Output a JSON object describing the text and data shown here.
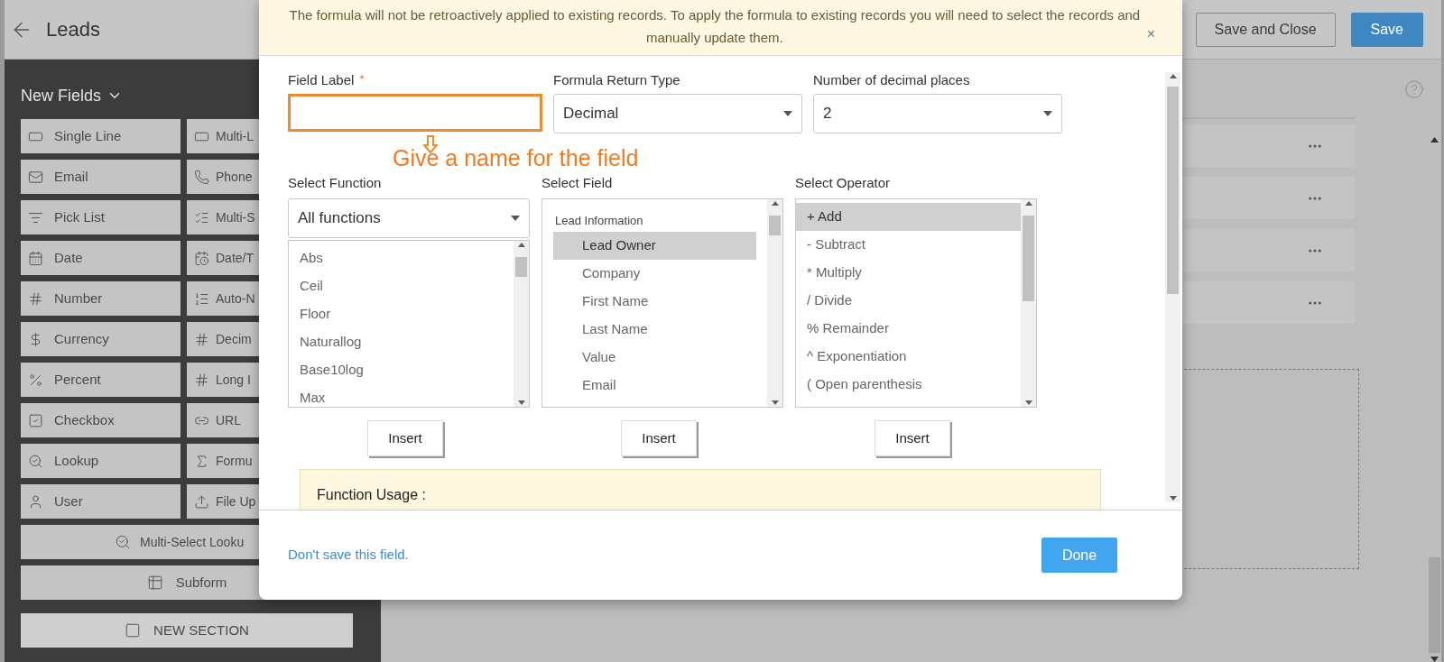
{
  "header": {
    "title": "Leads",
    "buttons": [
      {
        "label": "Save and Close",
        "kind": "secondary"
      },
      {
        "label": "Save",
        "kind": "primary"
      }
    ]
  },
  "sidebar": {
    "heading": "New Fields",
    "fields": [
      {
        "label": "Single Line"
      },
      {
        "label": "Multi-L"
      },
      {
        "label": "Email"
      },
      {
        "label": "Phone"
      },
      {
        "label": "Pick List"
      },
      {
        "label": "Multi-S"
      },
      {
        "label": "Date"
      },
      {
        "label": "Date/T"
      },
      {
        "label": "Number"
      },
      {
        "label": "Auto-N"
      },
      {
        "label": "Currency"
      },
      {
        "label": "Decim"
      },
      {
        "label": "Percent"
      },
      {
        "label": "Long I"
      },
      {
        "label": "Checkbox"
      },
      {
        "label": "URL"
      },
      {
        "label": "Lookup"
      },
      {
        "label": "Formu"
      },
      {
        "label": "User"
      },
      {
        "label": "File Up"
      }
    ],
    "wide_fields": [
      {
        "label": "Multi-Select Looku"
      },
      {
        "label": "Subform"
      },
      {
        "label": "NEW SECTION"
      }
    ]
  },
  "dialog": {
    "notice": "The formula will not be retroactively applied to existing records. To apply the formula to existing records you will need to select the records and manually update them.",
    "close": "×",
    "field_label": {
      "label": "Field Label",
      "required": "*"
    },
    "return_type": {
      "label": "Formula Return Type",
      "value": "Decimal"
    },
    "decimal_places": {
      "label": "Number of decimal places",
      "value": "2"
    },
    "annotation": "Give a name for the field",
    "lists": [
      {
        "label": "Select Function",
        "dropdown": "All functions",
        "items": [
          {
            "label": "Abs",
            "selected": false
          },
          {
            "label": "Ceil",
            "selected": false
          },
          {
            "label": "Floor",
            "selected": false
          },
          {
            "label": "Naturallog",
            "selected": false
          },
          {
            "label": "Base10log",
            "selected": false
          },
          {
            "label": "Max",
            "selected": false
          }
        ],
        "insert": "Insert"
      },
      {
        "label": "Select Field",
        "group": "Lead Information",
        "items": [
          {
            "label": "Lead Owner",
            "selected": true
          },
          {
            "label": "Company",
            "selected": false
          },
          {
            "label": "First Name",
            "selected": false
          },
          {
            "label": "Last Name",
            "selected": false
          },
          {
            "label": "Value",
            "selected": false
          },
          {
            "label": "Email",
            "selected": false
          }
        ],
        "insert": "Insert"
      },
      {
        "label": "Select Operator",
        "items": [
          {
            "label": "+ Add",
            "selected": true
          },
          {
            "label": "- Subtract",
            "selected": false
          },
          {
            "label": "* Multiply",
            "selected": false
          },
          {
            "label": "/ Divide",
            "selected": false
          },
          {
            "label": "% Remainder",
            "selected": false
          },
          {
            "label": "^ Exponentiation",
            "selected": false
          },
          {
            "label": "( Open parenthesis",
            "selected": false
          }
        ],
        "insert": "Insert"
      }
    ],
    "usage_title": "Function Usage :",
    "discard_link": "Don't save this field.",
    "done": "Done"
  }
}
